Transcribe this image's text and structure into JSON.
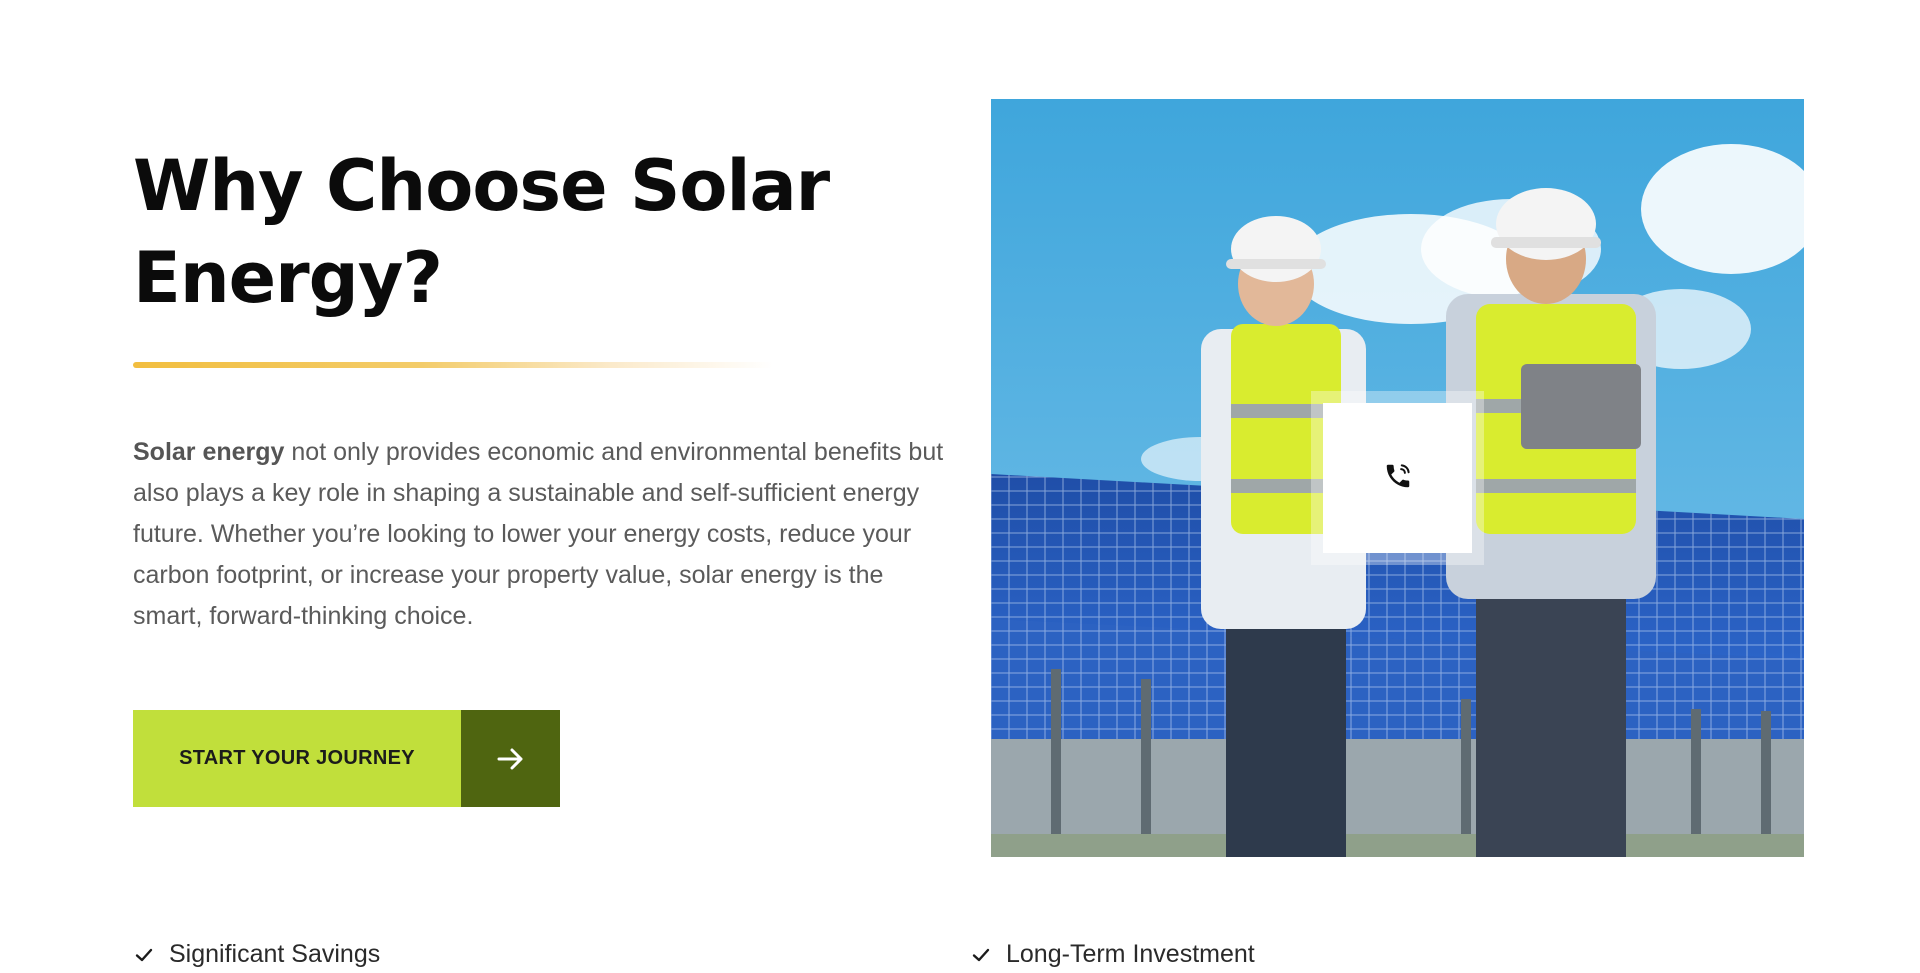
{
  "heading": "Why Choose Solar Energy?",
  "intro": {
    "lead": "Solar energy",
    "text": " not only provides economic and environmental benefits but also plays a key role in shaping a sustainable and self-sufficient energy future. Whether you’re looking to lower your energy costs, reduce your carbon footprint, or increase your property value, solar energy is the smart, forward-thinking choice."
  },
  "cta": {
    "label": "START YOUR JOURNEY",
    "icon": "arrow-right-icon"
  },
  "photo": {
    "icon": "phone-icon"
  },
  "features": [
    {
      "label": "Significant Savings",
      "icon": "check-icon"
    },
    {
      "label": "Long-Term Investment",
      "icon": "check-icon"
    }
  ],
  "colors": {
    "accent": "#c1df3b",
    "accent_dark": "#4f6510",
    "divider": "#f2be3f"
  }
}
